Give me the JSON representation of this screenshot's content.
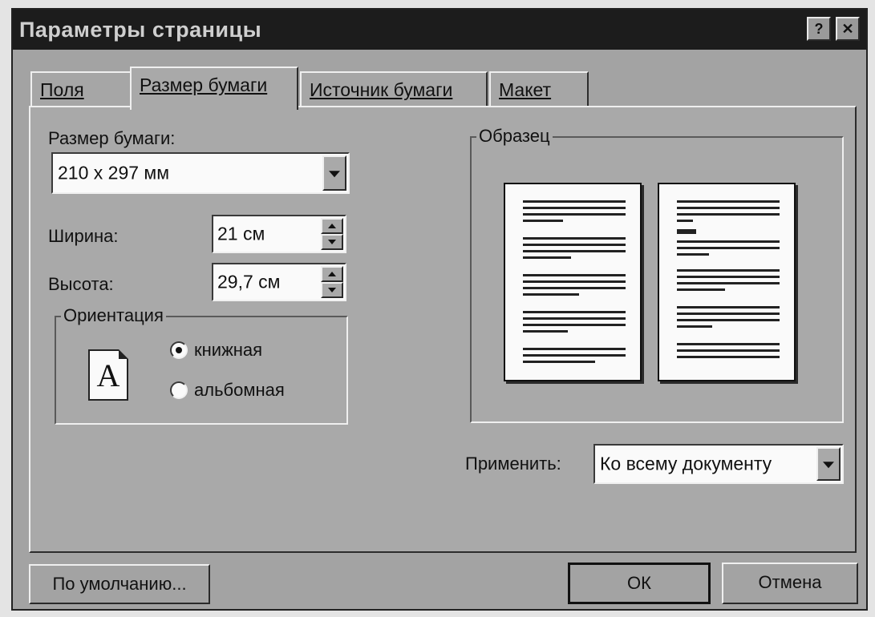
{
  "window": {
    "title": "Параметры страницы",
    "help_glyph": "?",
    "close_glyph": "✕"
  },
  "tabs": [
    {
      "label": "Поля",
      "active": false
    },
    {
      "label": "Размер бумаги",
      "active": true
    },
    {
      "label": "Источник бумаги",
      "active": false
    },
    {
      "label": "Макет",
      "active": false
    }
  ],
  "paper": {
    "size_label": "Размер бумаги:",
    "size_value": "210 x 297 мм",
    "width_label": "Ширина:",
    "width_value": "21 см",
    "height_label": "Высота:",
    "height_value": "29,7 см"
  },
  "orientation": {
    "legend": "Ориентация",
    "icon_letter": "A",
    "options": [
      {
        "label": "книжная",
        "selected": true
      },
      {
        "label": "альбомная",
        "selected": false
      }
    ]
  },
  "preview": {
    "legend": "Образец"
  },
  "apply": {
    "label": "Применить:",
    "value": "Ко всему документу"
  },
  "buttons": {
    "default_label": "По умолчанию...",
    "ok_label": "ОК",
    "cancel_label": "Отмена"
  },
  "icons": {
    "help": "help-icon",
    "close": "close-icon",
    "dropdown": "chevron-down-icon",
    "orientation": "portrait-page-icon"
  }
}
